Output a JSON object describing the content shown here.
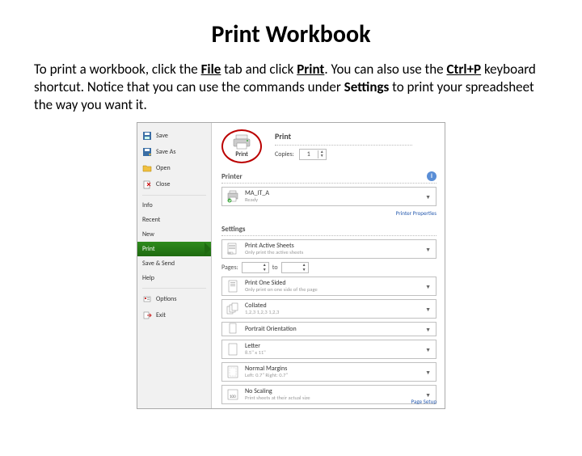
{
  "doc": {
    "title": "Print Workbook",
    "instr_prefix": "To print a workbook, click the ",
    "file_word": "File",
    "instr_mid1": " tab and click ",
    "print_word": "Print",
    "instr_mid2": ". You can also use the ",
    "shortcut": "Ctrl+P",
    "instr_mid3": " keyboard shortcut. Notice that you can use the commands under ",
    "settings_word": "Settings",
    "instr_end": " to print your spreadsheet the way you want it."
  },
  "sidebar": {
    "save": "Save",
    "save_as": "Save As",
    "open": "Open",
    "close": "Close",
    "info": "Info",
    "recent": "Recent",
    "new": "New",
    "print": "Print",
    "save_send": "Save & Send",
    "help": "Help",
    "options": "Options",
    "exit": "Exit"
  },
  "print": {
    "heading": "Print",
    "btn_label": "Print",
    "copies_label": "Copies:",
    "copies_value": "1"
  },
  "printer": {
    "section": "Printer",
    "name": "MA_IT_A",
    "status": "Ready",
    "props_link": "Printer Properties"
  },
  "settings": {
    "section": "Settings",
    "active_sheets": {
      "main": "Print Active Sheets",
      "sub": "Only print the active sheets"
    },
    "pages_label": "Pages:",
    "pages_to": "to",
    "one_sided": {
      "main": "Print One Sided",
      "sub": "Only print on one side of the page"
    },
    "collated": {
      "main": "Collated",
      "sub": "1,2,3   1,2,3   1,2,3"
    },
    "orientation": {
      "main": "Portrait Orientation"
    },
    "paper": {
      "main": "Letter",
      "sub": "8.5\" x 11\""
    },
    "margins": {
      "main": "Normal Margins",
      "sub": "Left: 0.7\"   Right: 0.7\""
    },
    "scaling": {
      "main": "No Scaling",
      "sub": "Print sheets at their actual size"
    },
    "page_setup": "Page Setup"
  }
}
